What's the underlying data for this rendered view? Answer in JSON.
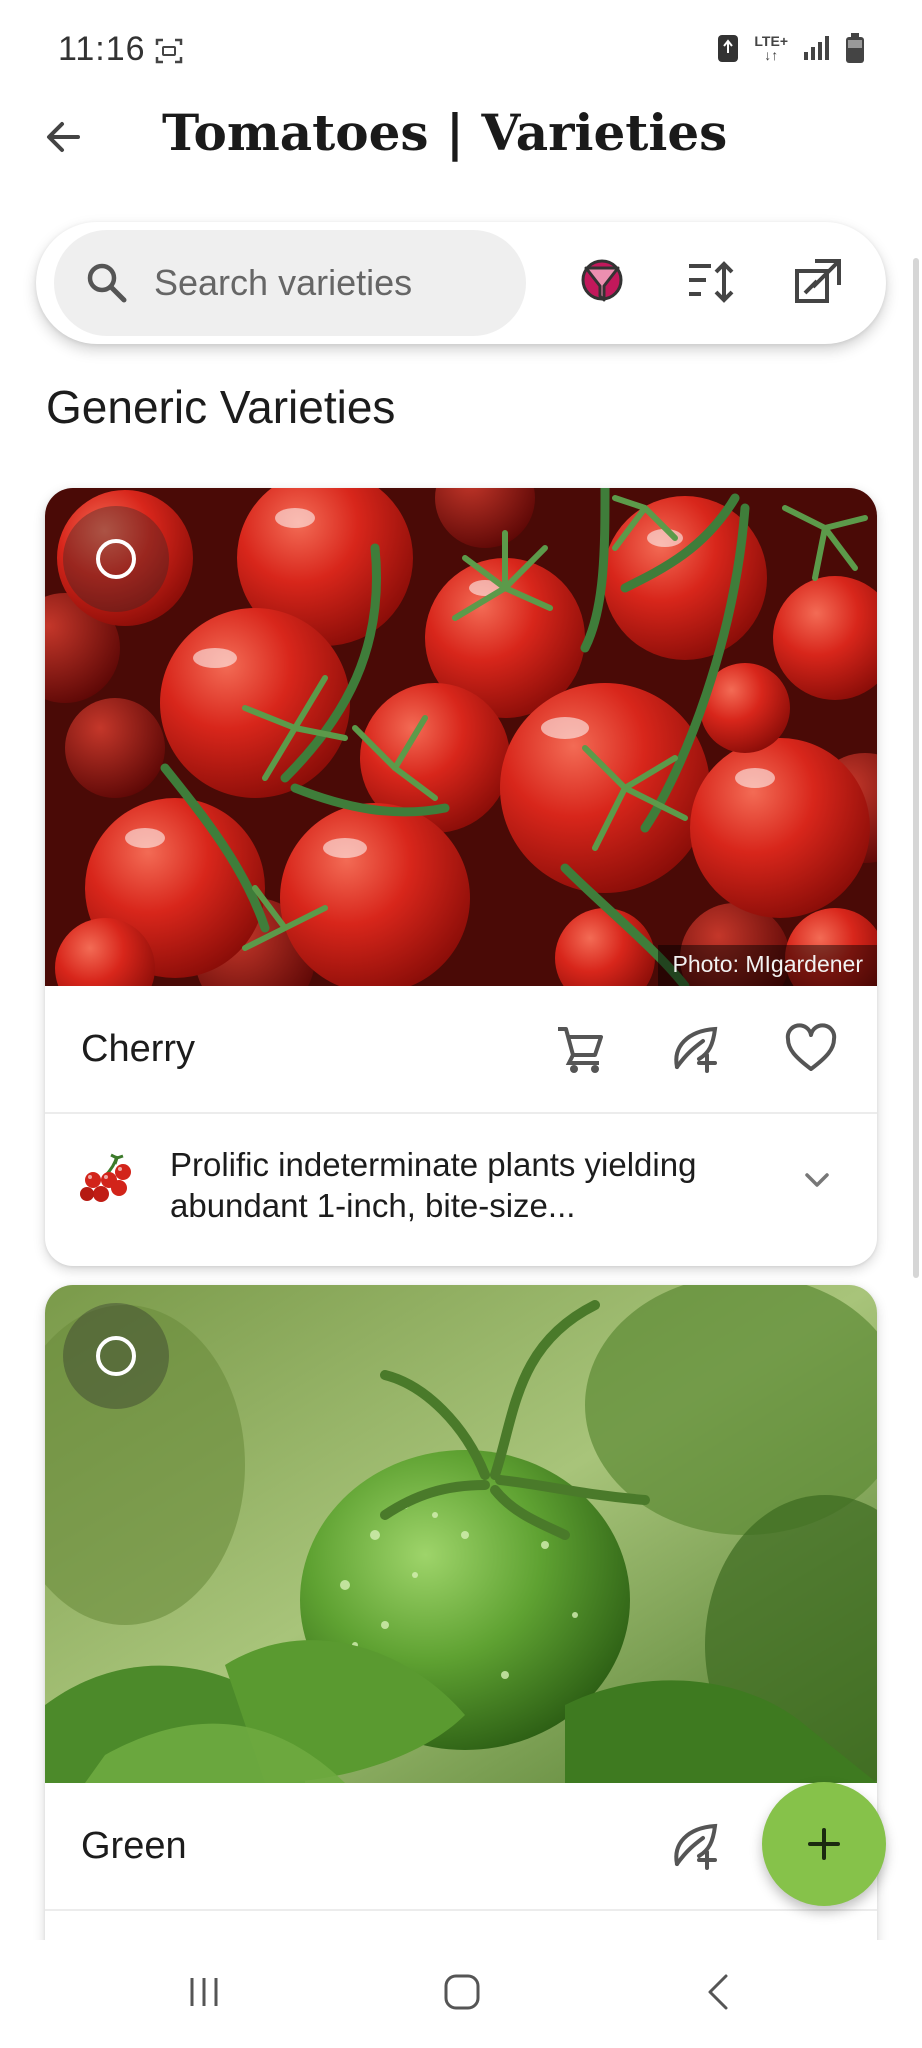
{
  "status_bar": {
    "time": "11:16",
    "network_label": "LTE+"
  },
  "header": {
    "title": "Tomatoes | Varieties",
    "back_icon": "arrow-left-icon"
  },
  "search": {
    "placeholder": "Search varieties",
    "filter_icon": "filter-icon",
    "sort_icon": "sort-icon",
    "open_external_icon": "open-in-new-icon",
    "filter_color": "#c2185b"
  },
  "section": {
    "title": "Generic Varieties"
  },
  "varieties": [
    {
      "name": "Cherry",
      "photo_credit": "Photo: MIgardener",
      "description": "Prolific indeterminate plants yielding abundant 1-inch, bite-size...",
      "actions": [
        "cart-icon",
        "add-plant-icon",
        "heart-icon"
      ]
    },
    {
      "name": "Green",
      "actions": [
        "add-plant-icon"
      ]
    }
  ],
  "fab": {
    "icon": "plus-icon",
    "color": "#86c24a"
  },
  "colors": {
    "tomato_red": "#d2241a",
    "leaf_green": "#4f8a2c"
  }
}
